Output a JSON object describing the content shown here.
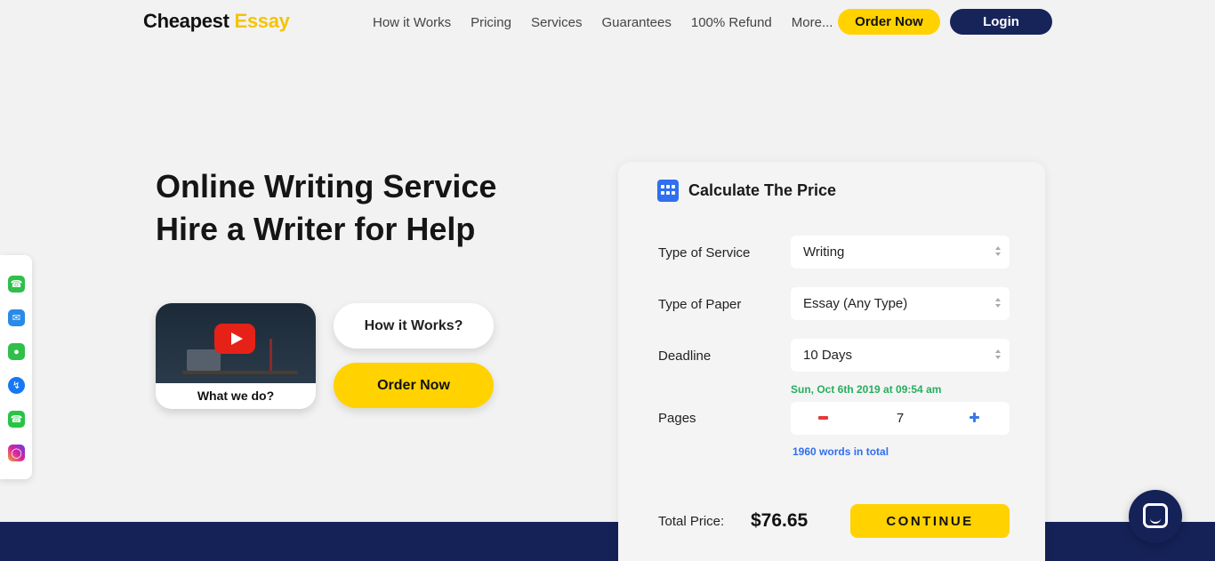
{
  "header": {
    "logo_part1": "Cheapest",
    "logo_part2": "Essay",
    "nav": [
      "How it Works",
      "Pricing",
      "Services",
      "Guarantees",
      "100% Refund",
      "More..."
    ],
    "order_now_label": "Order Now",
    "login_label": "Login"
  },
  "hero": {
    "title_line1": "Online Writing Service",
    "title_line2": "Hire a Writer for Help",
    "video_label": "What we do?",
    "how_it_works_label": "How it Works?",
    "order_now_label": "Order Now"
  },
  "calculator": {
    "title": "Calculate The Price",
    "service_label": "Type of Service",
    "service_value": "Writing",
    "paper_label": "Type of Paper",
    "paper_value": "Essay (Any Type)",
    "deadline_label": "Deadline",
    "deadline_value": "10 Days",
    "deadline_date": "Sun, Oct 6th 2019 at 09:54 am",
    "pages_label": "Pages",
    "pages_value": "7",
    "words_total": "1960 words in total",
    "total_label": "Total Price:",
    "total_value": "$76.65",
    "continue_label": "CONTINUE"
  },
  "colors": {
    "accent_yellow": "#ffd200",
    "brand_navy": "#142257",
    "deadline_green": "#27ae60",
    "link_blue": "#2f6ff0"
  },
  "icons": {
    "sidebar": [
      "phone-icon",
      "mail-icon",
      "imessage-icon",
      "messenger-icon",
      "whatsapp-icon",
      "instagram-icon"
    ],
    "calculator": "calculator-icon",
    "video": "youtube-play-icon",
    "chat": "chat-icon"
  }
}
